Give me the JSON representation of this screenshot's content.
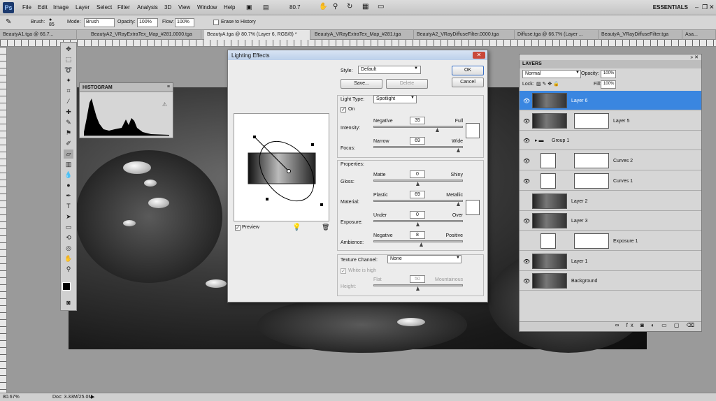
{
  "menubar": {
    "logo": "Ps",
    "items": [
      "File",
      "Edit",
      "Image",
      "Layer",
      "Select",
      "Filter",
      "Analysis",
      "3D",
      "View",
      "Window",
      "Help"
    ],
    "zoom": "80.7",
    "workspace": "ESSENTIALS"
  },
  "options": {
    "brush_label": "Brush:",
    "brush_size": "85",
    "mode_label": "Mode:",
    "mode_value": "Brush",
    "opacity_label": "Opacity:",
    "opacity_value": "100%",
    "flow_label": "Flow:",
    "flow_value": "100%",
    "erase_label": "Erase to History"
  },
  "tabs": [
    "BeautyA1.tga @ 66.7...",
    "BeautyA2_VRayExtraTex_Map_#281.0000.tga",
    "BeautyA.tga @ 80.7% (Layer 6, RGB/8) *",
    "BeautyA_VRayExtraTex_Map_#281.tga",
    "BeautyA2_VRayDiffuseFilter.0000.tga",
    "Diffuse.tga @ 66.7% (Layer ...",
    "BeautyA_VRayDiffuseFilter.tga",
    "Asa..."
  ],
  "histogram": {
    "title": "HISTOGRAM"
  },
  "dialog": {
    "title": "Lighting Effects",
    "ok": "OK",
    "cancel": "Cancel",
    "style_label": "Style:",
    "style_value": "Default",
    "save": "Save...",
    "delete": "Delete",
    "light_type_label": "Light Type:",
    "light_type_value": "Spotlight",
    "on_label": "On",
    "intensity": {
      "label": "Intensity:",
      "left": "Negative",
      "right": "Full",
      "value": "35",
      "fraction": 0.72
    },
    "focus": {
      "label": "Focus:",
      "left": "Narrow",
      "right": "Wide",
      "value": "69",
      "fraction": 0.95
    },
    "properties_label": "Properties:",
    "gloss": {
      "label": "Gloss:",
      "left": "Matte",
      "right": "Shiny",
      "value": "0",
      "fraction": 0.5
    },
    "material": {
      "label": "Material:",
      "left": "Plastic",
      "right": "Metallic",
      "value": "69",
      "fraction": 0.95
    },
    "exposure": {
      "label": "Exposure:",
      "left": "Under",
      "right": "Over",
      "value": "0",
      "fraction": 0.5
    },
    "ambience": {
      "label": "Ambience:",
      "left": "Negative",
      "right": "Positive",
      "value": "8",
      "fraction": 0.54
    },
    "texture_label": "Texture Channel:",
    "texture_value": "None",
    "white_high": "White is high",
    "height": {
      "label": "Height:",
      "left": "Flat",
      "right": "Mountainous",
      "value": "50",
      "fraction": 0.5
    },
    "preview_label": "Preview"
  },
  "layers": {
    "title": "LAYERS",
    "blend": "Normal",
    "opacity_label": "Opacity:",
    "opacity_value": "100%",
    "lock_label": "Lock:",
    "fill_label": "Fill:",
    "fill_value": "100%",
    "rows": [
      {
        "name": "Layer 6",
        "kind": "photo",
        "visible": true,
        "active": true
      },
      {
        "name": "Layer 5",
        "kind": "photo-mask",
        "visible": true,
        "active": false
      },
      {
        "name": "Group 1",
        "kind": "group",
        "visible": true,
        "active": false
      },
      {
        "name": "Curves 2",
        "kind": "adj",
        "visible": true,
        "active": false
      },
      {
        "name": "Curves 1",
        "kind": "adj",
        "visible": true,
        "active": false
      },
      {
        "name": "Layer 2",
        "kind": "photo",
        "visible": false,
        "active": false
      },
      {
        "name": "Layer 3",
        "kind": "photo",
        "visible": true,
        "active": false
      },
      {
        "name": "Exposure 1",
        "kind": "adj",
        "visible": false,
        "active": false
      },
      {
        "name": "Layer 1",
        "kind": "photo",
        "visible": true,
        "active": false
      },
      {
        "name": "Background",
        "kind": "photo",
        "visible": true,
        "active": false
      }
    ]
  },
  "status": {
    "zoom": "80.67%",
    "doc": "Doc: 3.33M/25.0M"
  }
}
